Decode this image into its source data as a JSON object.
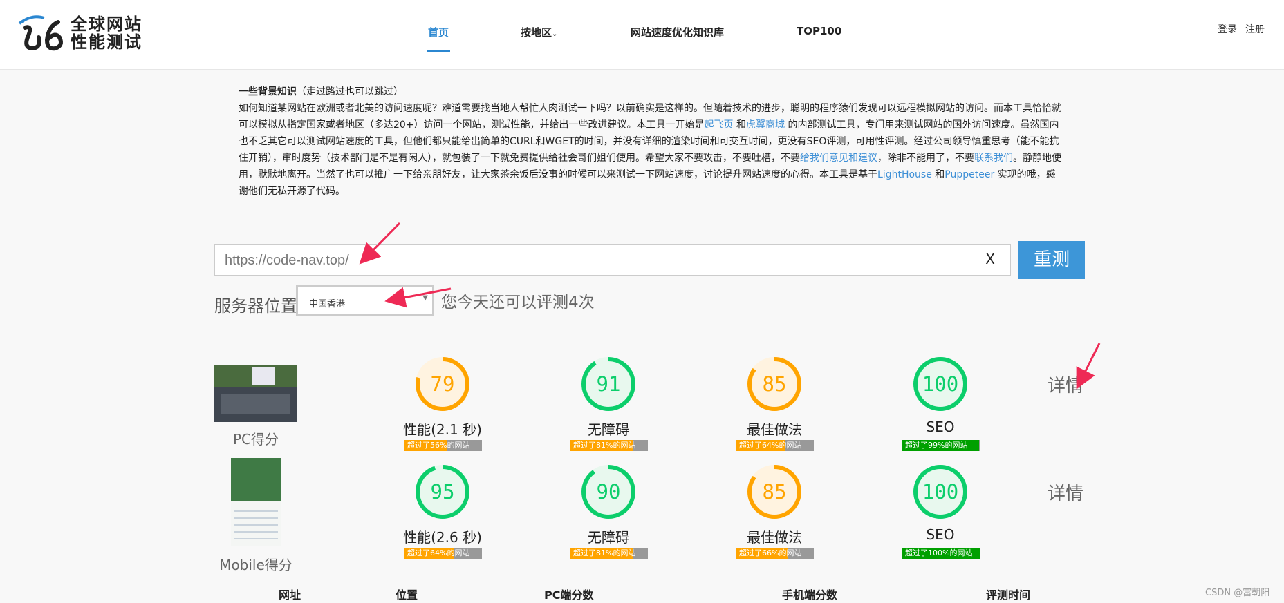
{
  "header": {
    "logo_line1": "全球网站",
    "logo_line2": "性能测试",
    "nav": [
      "首页",
      "按地区",
      "网站速度优化知识库",
      "TOP100"
    ],
    "login": "登录",
    "register": "注册"
  },
  "background": {
    "title": "一些背景知识",
    "title_note": "（走过路过也可以跳过）",
    "p1": "如何知道某网站在欧洲或者北美的访问速度呢？难道需要找当地人帮忙人肉测试一下吗？以前确实是这样的。但随着技术的进步，聪明的程序猿们发现可以远程模拟网站的访问。而本工具恰恰就可以模拟从指定国家或者地区（多达20+）访问一个网站，测试性能，并给出一些改进建议。本工具一开始是",
    "link1": "起飞页",
    "p2": " 和",
    "link2": "虎翼商城",
    "p3": " 的内部测试工具，专门用来测试网站的国外访问速度。虽然国内也不乏其它可以测试网站速度的工具，但他们都只能给出简单的CURL和WGET的时间，并没有详细的渲染时间和可交互时间，更没有SEO评测，可用性评测。经过公司领导慎重思考（能不能抗住开销），审时度势（技术部门是不是有闲人），就包装了一下就免费提供给社会哥们姐们使用。希望大家不要攻击，不要吐槽，不要",
    "link3": "给我们意见和建议",
    "p4": "，除非不能用了，不要",
    "link4": "联系我们",
    "p5": "。静静地使用，默默地离开。当然了也可以推广一下给亲朋好友，让大家茶余饭后没事的时候可以来测试一下网站速度，讨论提升网站速度的心得。本工具是基于",
    "link5": "LightHouse",
    "p6": " 和",
    "link6": "Puppeteer",
    "p7": " 实现的哦，感谢他们无私开源了代码。"
  },
  "search": {
    "placeholder": "https://code-nav.top/",
    "clear": "X",
    "button": "重测"
  },
  "location": {
    "label": "服务器位置",
    "selected": "中国香港",
    "remaining": "您今天还可以评测4次"
  },
  "results": {
    "pc": {
      "label": "PC得分",
      "detail": "详情",
      "metrics": [
        {
          "score": "79",
          "value": 0.79,
          "name": "性能(2.1 秒)",
          "beat": "超过了56%的网站",
          "beat_pct": 0.56,
          "level": "avg"
        },
        {
          "score": "91",
          "value": 0.91,
          "name": "无障碍",
          "beat": "超过了81%的网站",
          "beat_pct": 0.81,
          "level": "good"
        },
        {
          "score": "85",
          "value": 0.85,
          "name": "最佳做法",
          "beat": "超过了64%的网站",
          "beat_pct": 0.64,
          "level": "avg"
        },
        {
          "score": "100",
          "value": 1.0,
          "name": "SEO",
          "beat": "超过了99%的网站",
          "beat_pct": 0.99,
          "level": "good"
        }
      ]
    },
    "mobile": {
      "label": "Mobile得分",
      "detail": "详情",
      "metrics": [
        {
          "score": "95",
          "value": 0.95,
          "name": "性能(2.6 秒)",
          "beat": "超过了64%的网站",
          "beat_pct": 0.64,
          "level": "good"
        },
        {
          "score": "90",
          "value": 0.9,
          "name": "无障碍",
          "beat": "超过了81%的网站",
          "beat_pct": 0.81,
          "level": "good"
        },
        {
          "score": "85",
          "value": 0.85,
          "name": "最佳做法",
          "beat": "超过了66%的网站",
          "beat_pct": 0.66,
          "level": "avg"
        },
        {
          "score": "100",
          "value": 1.0,
          "name": "SEO",
          "beat": "超过了100%的网站",
          "beat_pct": 1.0,
          "level": "good"
        }
      ]
    }
  },
  "table_headers": [
    "网址",
    "位置",
    "PC端分数",
    "手机端分数",
    "评测时间"
  ],
  "watermark": "CSDN @富朝阳",
  "colors": {
    "accent": "#2b87d1",
    "link": "#3d8fd6",
    "good": "#0cce6b",
    "good_bg": "#e8f8ee",
    "avg": "#ffa400",
    "avg_bg": "#fff3e0",
    "bar_orange": "#ffa400",
    "bar_green": "#00a000",
    "annotation_arrow": "#ee2a55"
  }
}
